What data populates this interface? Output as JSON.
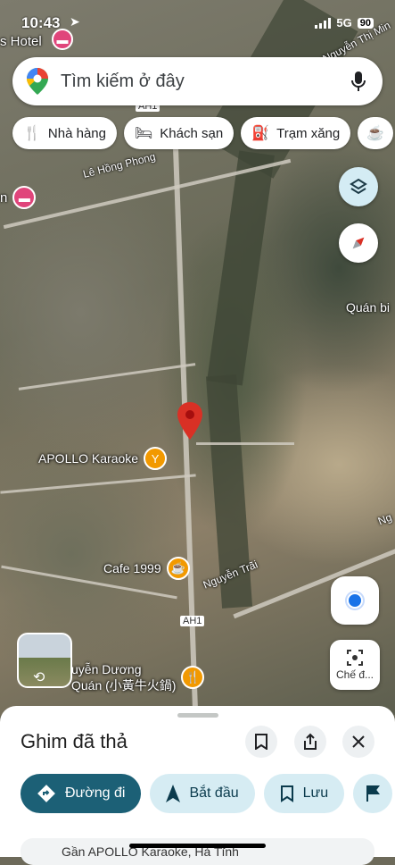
{
  "status": {
    "time": "10:43",
    "network": "5G",
    "battery": "90"
  },
  "search": {
    "placeholder": "Tìm kiếm ở đây"
  },
  "chips": [
    {
      "label": "Nhà hàng",
      "icon": "restaurant-icon"
    },
    {
      "label": "Khách sạn",
      "icon": "hotel-icon"
    },
    {
      "label": "Trạm xăng",
      "icon": "gas-station-icon"
    }
  ],
  "map": {
    "labels": {
      "hotel_top": "s Hotel",
      "le_hong_phong": "Lê Hồng Phong",
      "nguyen_thi_minh": "Nguyễn Thị Min",
      "quan_bi": "Quán bi",
      "ah1_top": "AH1",
      "ah1_bottom": "AH1",
      "nguyen_trai": "Nguyễn Trãi",
      "ng_right": "Ng"
    },
    "pois": {
      "apollo": "APOLLO Karaoke",
      "cafe": "Cafe 1999",
      "restaurant": "uyễn Dương\nQuán (小黃牛火鍋)"
    },
    "streetview_label": "Chế đ..."
  },
  "sheet": {
    "title": "Ghim đã thả",
    "actions": {
      "directions": "Đường đi",
      "start": "Bắt đầu",
      "save": "Lưu"
    },
    "address": "Gần APOLLO Karaoke, Hà Tĩnh"
  },
  "colors": {
    "primary": "#1c6076",
    "secondary": "#d6ecf3",
    "pin": "#d93025"
  }
}
